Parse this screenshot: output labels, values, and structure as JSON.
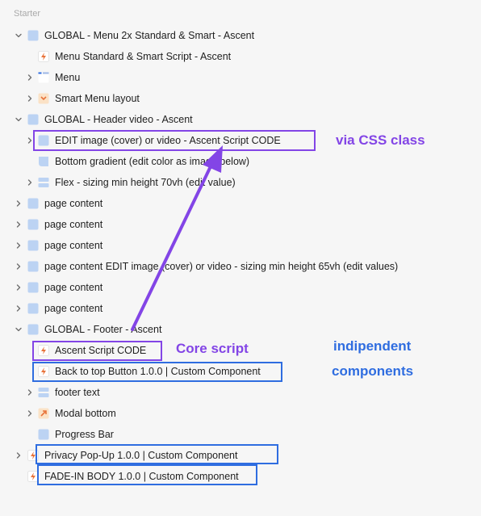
{
  "panel": {
    "section_label": "Starter"
  },
  "tree": [
    {
      "label": "GLOBAL - Menu 2x Standard & Smart - Ascent",
      "depth": 1,
      "chev": "down",
      "icon": "section-icon"
    },
    {
      "label": "Menu Standard & Smart Script - Ascent",
      "depth": 2,
      "chev": "none",
      "icon": "script-bolt-icon"
    },
    {
      "label": "Menu",
      "depth": 2,
      "chev": "right",
      "icon": "menu-icon"
    },
    {
      "label": "Smart Menu layout",
      "depth": 2,
      "chev": "right",
      "icon": "smart-menu-icon"
    },
    {
      "label": "GLOBAL - Header video - Ascent",
      "depth": 1,
      "chev": "down",
      "icon": "section-icon"
    },
    {
      "label": "EDIT image (cover) or video - Ascent Script CODE",
      "depth": 2,
      "chev": "right",
      "icon": "section-icon"
    },
    {
      "label": "Bottom gradient (edit color as image below)",
      "depth": 2,
      "chev": "none",
      "icon": "gradient-icon"
    },
    {
      "label": "Flex - sizing min height 70vh (edit value)",
      "depth": 2,
      "chev": "right",
      "icon": "flex-icon"
    },
    {
      "label": "page content",
      "depth": 1,
      "chev": "right",
      "icon": "section-icon"
    },
    {
      "label": "page content",
      "depth": 1,
      "chev": "right",
      "icon": "section-icon"
    },
    {
      "label": "page content",
      "depth": 1,
      "chev": "right",
      "icon": "section-icon"
    },
    {
      "label": "page content EDIT image (cover) or video - sizing min height 65vh (edit values)",
      "depth": 1,
      "chev": "right",
      "icon": "section-icon"
    },
    {
      "label": "page content",
      "depth": 1,
      "chev": "right",
      "icon": "section-icon"
    },
    {
      "label": "page content",
      "depth": 1,
      "chev": "right",
      "icon": "section-icon"
    },
    {
      "label": "GLOBAL - Footer - Ascent",
      "depth": 1,
      "chev": "down",
      "icon": "section-icon"
    },
    {
      "label": "Ascent Script CODE",
      "depth": 2,
      "chev": "none",
      "icon": "script-bolt-icon"
    },
    {
      "label": "Back to top Button 1.0.0 | Custom Component",
      "depth": 2,
      "chev": "none",
      "icon": "script-bolt-icon"
    },
    {
      "label": "footer text",
      "depth": 2,
      "chev": "right",
      "icon": "footer-text-icon"
    },
    {
      "label": "Modal bottom",
      "depth": 2,
      "chev": "right",
      "icon": "modal-icon"
    },
    {
      "label": "Progress Bar",
      "depth": 2,
      "chev": "none",
      "icon": "section-icon"
    },
    {
      "label": "Privacy Pop-Up 1.0.0 | Custom Component",
      "depth": 1,
      "chev": "right",
      "icon": "script-bolt-icon"
    },
    {
      "label": "FADE-IN BODY 1.0.0 | Custom Component",
      "depth": 1,
      "chev": "none",
      "icon": "script-bolt-icon"
    }
  ],
  "annotations": {
    "via_css_class": "via CSS class",
    "core_script": "Core script",
    "independent_components_line1": "indipendent",
    "independent_components_line2": "components"
  },
  "colors": {
    "purple": "#8345e6",
    "blue": "#2f6de0",
    "section_icon": "#bcd3f3",
    "bolt": "#e8733a"
  }
}
